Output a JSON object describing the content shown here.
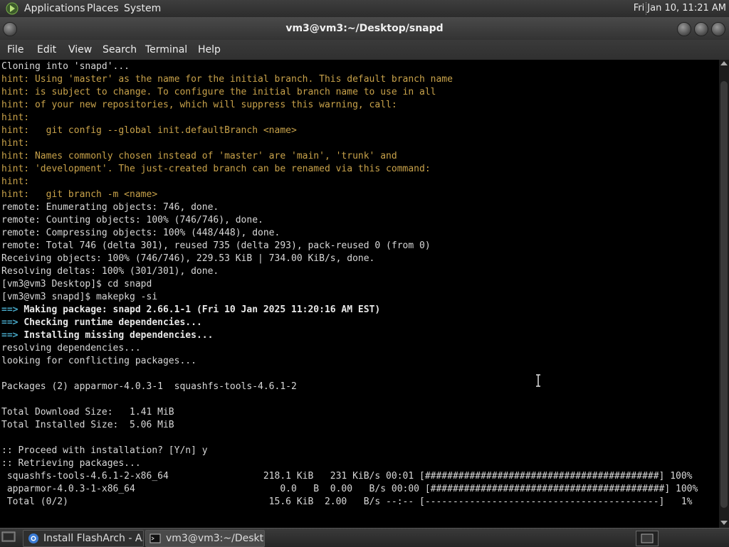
{
  "top_panel": {
    "menus": [
      "Applications",
      "Places",
      "System"
    ],
    "clock": "Fri Jan 10, 11:21 AM"
  },
  "window": {
    "title": "vm3@vm3:~/Desktop/snapd"
  },
  "menubar": [
    "File",
    "Edit",
    "View",
    "Search",
    "Terminal",
    "Help"
  ],
  "terminal": {
    "lines": [
      {
        "text": "Cloning into 'snapd'...",
        "style": "normal"
      },
      {
        "text": "hint: Using 'master' as the name for the initial branch. This default branch name",
        "style": "hint"
      },
      {
        "text": "hint: is subject to change. To configure the initial branch name to use in all",
        "style": "hint"
      },
      {
        "text": "hint: of your new repositories, which will suppress this warning, call:",
        "style": "hint"
      },
      {
        "text": "hint:",
        "style": "hint"
      },
      {
        "text": "hint:   git config --global init.defaultBranch <name>",
        "style": "hint"
      },
      {
        "text": "hint:",
        "style": "hint"
      },
      {
        "text": "hint: Names commonly chosen instead of 'master' are 'main', 'trunk' and",
        "style": "hint"
      },
      {
        "text": "hint: 'development'. The just-created branch can be renamed via this command:",
        "style": "hint"
      },
      {
        "text": "hint:",
        "style": "hint"
      },
      {
        "text": "hint:   git branch -m <name>",
        "style": "hint"
      },
      {
        "text": "remote: Enumerating objects: 746, done.",
        "style": "normal"
      },
      {
        "text": "remote: Counting objects: 100% (746/746), done.",
        "style": "normal"
      },
      {
        "text": "remote: Compressing objects: 100% (448/448), done.",
        "style": "normal"
      },
      {
        "text": "remote: Total 746 (delta 301), reused 735 (delta 293), pack-reused 0 (from 0)",
        "style": "normal"
      },
      {
        "text": "Receiving objects: 100% (746/746), 229.53 KiB | 734.00 KiB/s, done.",
        "style": "normal"
      },
      {
        "text": "Resolving deltas: 100% (301/301), done.",
        "style": "normal"
      },
      {
        "text": "[vm3@vm3 Desktop]$ cd snapd",
        "style": "normal"
      },
      {
        "text": "[vm3@vm3 snapd]$ makepkg -si",
        "style": "normal"
      },
      {
        "prefix": "==> ",
        "text": "Making package: snapd 2.66.1-1 (Fri 10 Jan 2025 11:20:16 AM EST)",
        "style": "arrow"
      },
      {
        "prefix": "==> ",
        "text": "Checking runtime dependencies...",
        "style": "arrow"
      },
      {
        "prefix": "==> ",
        "text": "Installing missing dependencies...",
        "style": "arrow"
      },
      {
        "text": "resolving dependencies...",
        "style": "normal"
      },
      {
        "text": "looking for conflicting packages...",
        "style": "normal"
      },
      {
        "text": "",
        "style": "normal"
      },
      {
        "text": "Packages (2) apparmor-4.0.3-1  squashfs-tools-4.6.1-2",
        "style": "normal"
      },
      {
        "text": "",
        "style": "normal"
      },
      {
        "text": "Total Download Size:   1.41 MiB",
        "style": "normal"
      },
      {
        "text": "Total Installed Size:  5.06 MiB",
        "style": "normal"
      },
      {
        "text": "",
        "style": "normal"
      },
      {
        "text": ":: Proceed with installation? [Y/n] y",
        "style": "normal"
      },
      {
        "text": ":: Retrieving packages...",
        "style": "normal"
      },
      {
        "text": " squashfs-tools-4.6.1-2-x86_64                 218.1 KiB   231 KiB/s 00:01 [##########################################] 100%",
        "style": "normal"
      },
      {
        "text": " apparmor-4.0.3-1-x86_64                          0.0   B  0.00   B/s 00:00 [##########################################] 100%",
        "style": "normal"
      },
      {
        "text": " Total (0/2)                                    15.6 KiB  2.00   B/s --:-- [------------------------------------------]   1%",
        "style": "normal"
      }
    ]
  },
  "taskbar": {
    "tasks": [
      {
        "label": "Install FlashArch - A...",
        "icon": "browser-icon"
      },
      {
        "label": "vm3@vm3:~/Deskt...",
        "icon": "terminal-icon"
      }
    ]
  },
  "colors": {
    "hint": "#c8a24a",
    "arrow": "#47a8c8",
    "text": "#d8d8d8",
    "background": "#000000"
  }
}
